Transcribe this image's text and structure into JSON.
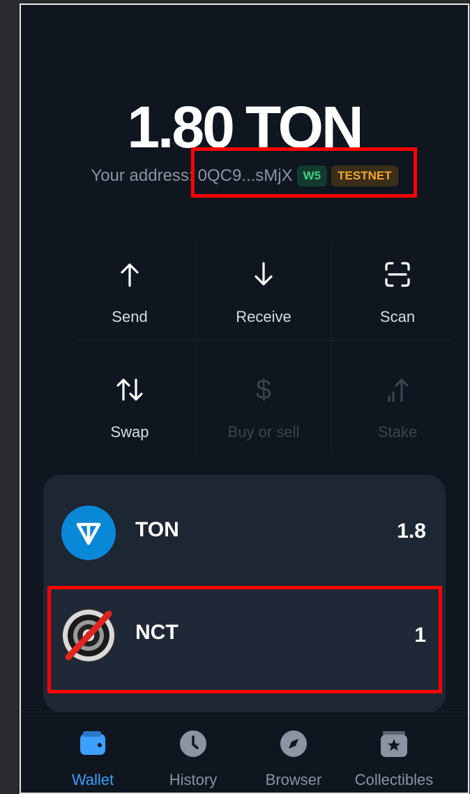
{
  "balance": {
    "amount": "1.80",
    "currency": "TON"
  },
  "address": {
    "label": "Your address:",
    "value": "0QC9...sMjX",
    "version_badge": "W5",
    "network_badge": "TESTNET"
  },
  "actions": [
    {
      "label": "Send",
      "icon": "arrow-up-icon",
      "enabled": true
    },
    {
      "label": "Receive",
      "icon": "arrow-down-icon",
      "enabled": true
    },
    {
      "label": "Scan",
      "icon": "scan-icon",
      "enabled": true
    },
    {
      "label": "Swap",
      "icon": "swap-icon",
      "enabled": true
    },
    {
      "label": "Buy or sell",
      "icon": "dollar-icon",
      "enabled": false
    },
    {
      "label": "Stake",
      "icon": "stake-icon",
      "enabled": false
    }
  ],
  "assets": [
    {
      "name": "TON",
      "amount": "1.8",
      "icon": "ton-logo-icon"
    },
    {
      "name": "NCT",
      "amount": "1",
      "icon": "nct-token-icon"
    }
  ],
  "tabs": [
    {
      "label": "Wallet",
      "icon": "wallet-icon",
      "active": true
    },
    {
      "label": "History",
      "icon": "clock-icon",
      "active": false
    },
    {
      "label": "Browser",
      "icon": "compass-icon",
      "active": false
    },
    {
      "label": "Collectibles",
      "icon": "star-box-icon",
      "active": false
    }
  ],
  "colors": {
    "background": "#10161f",
    "card": "#1d2633",
    "accent": "#3d9fff",
    "highlight": "#ff0000",
    "testnet": "#f3a532",
    "w5": "#3fcf82"
  }
}
